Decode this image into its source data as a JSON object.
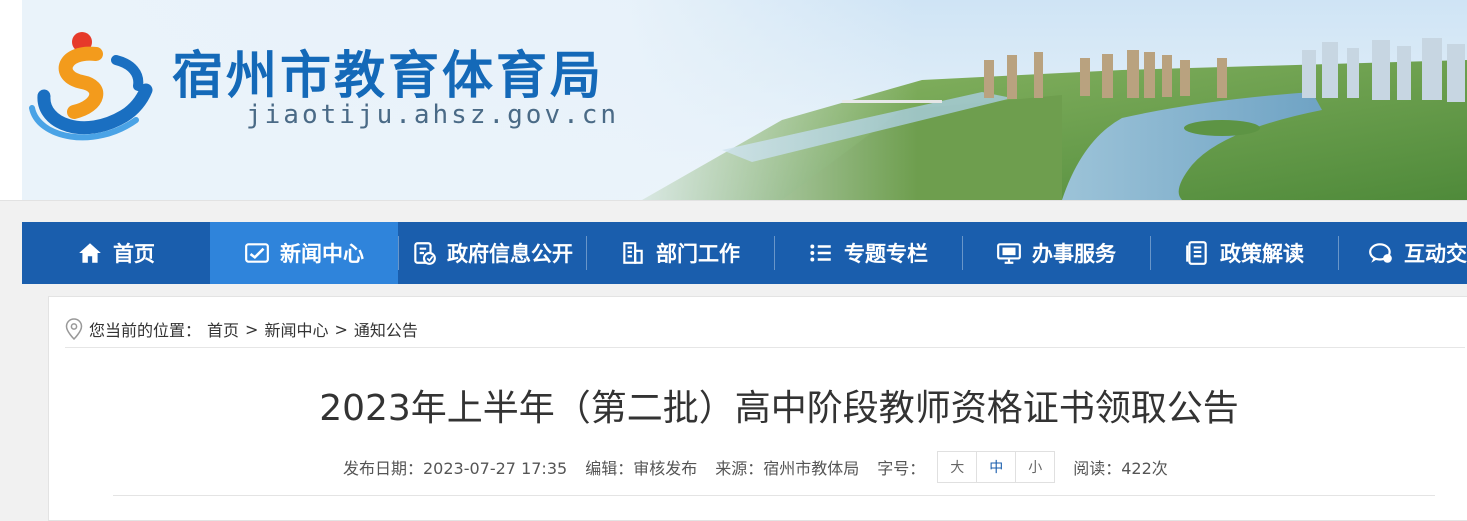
{
  "banner": {
    "title": "宿州市教育体育局",
    "url": "jiaotiju.ahsz.gov.cn"
  },
  "nav": {
    "items": [
      {
        "label": "首页",
        "icon": "home-icon"
      },
      {
        "label": "新闻中心",
        "icon": "news-icon"
      },
      {
        "label": "政府信息公开",
        "icon": "gov-info-icon"
      },
      {
        "label": "部门工作",
        "icon": "building-icon"
      },
      {
        "label": "专题专栏",
        "icon": "list-icon"
      },
      {
        "label": "办事服务",
        "icon": "monitor-icon"
      },
      {
        "label": "政策解读",
        "icon": "document-icon"
      },
      {
        "label": "互动交",
        "icon": "chat-icon"
      }
    ],
    "active_index": 1,
    "colors": {
      "bar": "#1a5ead",
      "active": "#2f84db"
    }
  },
  "breadcrumb": {
    "prefix": "您当前的位置：",
    "items": [
      "首页",
      "新闻中心",
      "通知公告"
    ],
    "separator": ">"
  },
  "article": {
    "title": "2023年上半年（第二批）高中阶段教师资格证书领取公告",
    "publish_date": "发布日期：2023-07-27 17:35",
    "editor": "编辑：审核发布",
    "source": "来源：宿州市教体局",
    "font_size_label": "字号：",
    "font_sizes": [
      "大",
      "中",
      "小"
    ],
    "selected_font_size": "中",
    "reads": "阅读：422次"
  }
}
